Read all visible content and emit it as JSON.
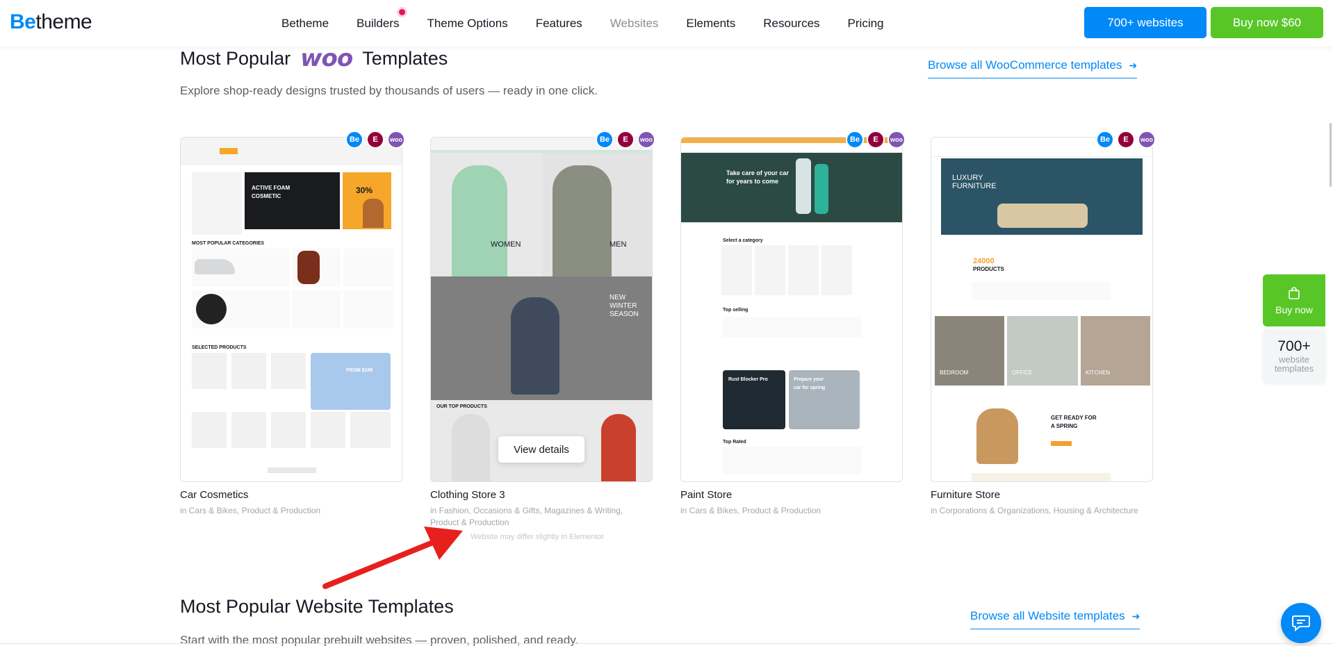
{
  "header": {
    "logo_be": "Be",
    "logo_rest": "theme",
    "nav": [
      "Betheme",
      "Builders",
      "Theme Options",
      "Features",
      "Websites",
      "Elements",
      "Resources",
      "Pricing"
    ],
    "btn_websites": "700+ websites",
    "btn_buy": "Buy now $60"
  },
  "section1": {
    "title_before": "Most Popular",
    "title_logo": "woo",
    "title_after": "Templates",
    "subtitle": "Explore shop-ready designs trusted by thousands of users — ready in one click.",
    "browse": "Browse all WooCommerce templates",
    "note": "Website may differ slightly in Elementor"
  },
  "cards": [
    {
      "title": "Car Cosmetics",
      "cats": "in Cars & Bikes, Product & Production"
    },
    {
      "title": "Clothing Store 3",
      "cats": "in Fashion, Occasions & Gifts, Magazines & Writing, Product & Production",
      "action": "View details"
    },
    {
      "title": "Paint Store",
      "cats": "in Cars & Bikes, Product & Production"
    },
    {
      "title": "Furniture Store",
      "cats": "in Corporations & Organizations, Housing & Architecture"
    }
  ],
  "badges": {
    "be": "Be",
    "el": "E",
    "woo": "woo"
  },
  "thumbs": {
    "car": {
      "hero": "ACTIVE FOAM COSMETIC",
      "sale": "30%",
      "cat_title": "MOST POPULAR CATEGORIES",
      "selected": "SELECTED PRODUCTS",
      "promo": "FROM $199"
    },
    "clothing": {
      "women": "WOMEN",
      "men": "MEN",
      "season": "NEW WINTER SEASON",
      "top": "OUR TOP PRODUCTS"
    },
    "paint": {
      "hero": "Take care of your car for years to come",
      "select": "Select a category",
      "top": "Top selling",
      "rust": "Rust Blocker Pro",
      "spring": "Prepare your car for spring",
      "rated": "Top Rated"
    },
    "furniture": {
      "hero": "LUXURY FURNITURE",
      "count": "24000",
      "products": "PRODUCTS",
      "bedroom": "BEDROOM",
      "office": "OFFICE",
      "kitchen": "KITCHEN",
      "spring": "GET READY FOR A SPRING"
    }
  },
  "section2": {
    "title": "Most Popular Website Templates",
    "subtitle": "Start with the most popular prebuilt websites — proven, polished, and ready.",
    "browse": "Browse all Website templates"
  },
  "side": {
    "buy": "Buy now",
    "count": "700+",
    "label1": "website",
    "label2": "templates"
  },
  "colors": {
    "accent": "#0089f7",
    "green": "#58c627",
    "woo": "#7f54b3",
    "elementor": "#92003b",
    "arrow": "#e8201d"
  }
}
